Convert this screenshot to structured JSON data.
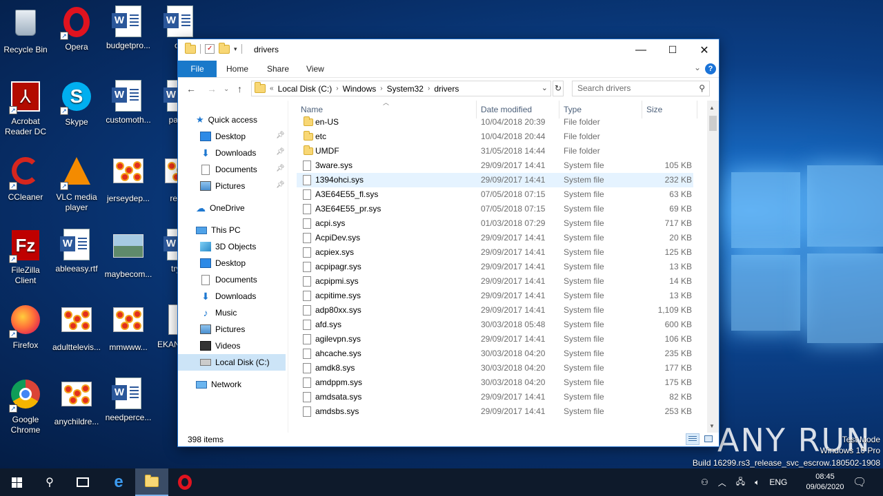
{
  "desktop": {
    "icons": [
      {
        "label": "Recycle Bin",
        "icon": "recycle-bin-icon"
      },
      {
        "label": "Opera",
        "icon": "opera-icon"
      },
      {
        "label": "budgetpro...",
        "icon": "word-doc-icon"
      },
      {
        "label": "ofc",
        "icon": "word-doc-icon"
      },
      {
        "label": "Acrobat Reader DC",
        "icon": "acrobat-icon"
      },
      {
        "label": "Skype",
        "icon": "skype-icon"
      },
      {
        "label": "customoth...",
        "icon": "word-doc-icon"
      },
      {
        "label": "pages",
        "icon": "word-doc-icon"
      },
      {
        "label": "CCleaner",
        "icon": "ccleaner-icon"
      },
      {
        "label": "VLC media player",
        "icon": "vlc-icon"
      },
      {
        "label": "jerseydep...",
        "icon": "image-icon"
      },
      {
        "label": "result",
        "icon": "image-icon"
      },
      {
        "label": "FileZilla Client",
        "icon": "filezilla-icon"
      },
      {
        "label": "ableeasy.rtf",
        "icon": "word-doc-icon"
      },
      {
        "label": "maybecom...",
        "icon": "landscape-image-icon"
      },
      {
        "label": "tryve",
        "icon": "word-doc-icon"
      },
      {
        "label": "Firefox",
        "icon": "firefox-icon"
      },
      {
        "label": "adulttelevis...",
        "icon": "image-icon"
      },
      {
        "label": "mmwww...",
        "icon": "image-icon"
      },
      {
        "label": "EKAN ranso",
        "icon": "document-icon"
      },
      {
        "label": "Google Chrome",
        "icon": "chrome-icon"
      },
      {
        "label": "anychildre...",
        "icon": "image-icon"
      },
      {
        "label": "needperce...",
        "icon": "word-doc-icon"
      }
    ]
  },
  "window": {
    "title": "drivers",
    "controls": {
      "minimize": "—",
      "maximize": "☐",
      "close": "✕"
    }
  },
  "ribbon": {
    "tabs": [
      "File",
      "Home",
      "Share",
      "View"
    ],
    "expand_icon": "chevron-down-icon",
    "help": "?"
  },
  "navbar": {
    "back": "←",
    "forward": "→",
    "up": "↑",
    "overflow": "«",
    "breadcrumb": [
      "Local Disk (C:)",
      "Windows",
      "System32",
      "drivers"
    ],
    "search_placeholder": "Search drivers"
  },
  "nav_pane": {
    "quick_access": "Quick access",
    "quick_items": [
      "Desktop",
      "Downloads",
      "Documents",
      "Pictures"
    ],
    "onedrive": "OneDrive",
    "this_pc": "This PC",
    "pc_items": [
      "3D Objects",
      "Desktop",
      "Documents",
      "Downloads",
      "Music",
      "Pictures",
      "Videos",
      "Local Disk (C:)"
    ],
    "network": "Network"
  },
  "columns": {
    "name": "Name",
    "date": "Date modified",
    "type": "Type",
    "size": "Size"
  },
  "files": [
    {
      "name": "en-US",
      "date": "10/04/2018 20:39",
      "type": "File folder",
      "size": "",
      "kind": "folder"
    },
    {
      "name": "etc",
      "date": "10/04/2018 20:44",
      "type": "File folder",
      "size": "",
      "kind": "folder"
    },
    {
      "name": "UMDF",
      "date": "31/05/2018 14:44",
      "type": "File folder",
      "size": "",
      "kind": "folder"
    },
    {
      "name": "3ware.sys",
      "date": "29/09/2017 14:41",
      "type": "System file",
      "size": "105 KB",
      "kind": "file"
    },
    {
      "name": "1394ohci.sys",
      "date": "29/09/2017 14:41",
      "type": "System file",
      "size": "232 KB",
      "kind": "file"
    },
    {
      "name": "A3E64E55_fl.sys",
      "date": "07/05/2018 07:15",
      "type": "System file",
      "size": "63 KB",
      "kind": "file"
    },
    {
      "name": "A3E64E55_pr.sys",
      "date": "07/05/2018 07:15",
      "type": "System file",
      "size": "69 KB",
      "kind": "file"
    },
    {
      "name": "acpi.sys",
      "date": "01/03/2018 07:29",
      "type": "System file",
      "size": "717 KB",
      "kind": "file"
    },
    {
      "name": "AcpiDev.sys",
      "date": "29/09/2017 14:41",
      "type": "System file",
      "size": "20 KB",
      "kind": "file"
    },
    {
      "name": "acpiex.sys",
      "date": "29/09/2017 14:41",
      "type": "System file",
      "size": "125 KB",
      "kind": "file"
    },
    {
      "name": "acpipagr.sys",
      "date": "29/09/2017 14:41",
      "type": "System file",
      "size": "13 KB",
      "kind": "file"
    },
    {
      "name": "acpipmi.sys",
      "date": "29/09/2017 14:41",
      "type": "System file",
      "size": "14 KB",
      "kind": "file"
    },
    {
      "name": "acpitime.sys",
      "date": "29/09/2017 14:41",
      "type": "System file",
      "size": "13 KB",
      "kind": "file"
    },
    {
      "name": "adp80xx.sys",
      "date": "29/09/2017 14:41",
      "type": "System file",
      "size": "1,109 KB",
      "kind": "file"
    },
    {
      "name": "afd.sys",
      "date": "30/03/2018 05:48",
      "type": "System file",
      "size": "600 KB",
      "kind": "file"
    },
    {
      "name": "agilevpn.sys",
      "date": "29/09/2017 14:41",
      "type": "System file",
      "size": "106 KB",
      "kind": "file"
    },
    {
      "name": "ahcache.sys",
      "date": "30/03/2018 04:20",
      "type": "System file",
      "size": "235 KB",
      "kind": "file"
    },
    {
      "name": "amdk8.sys",
      "date": "30/03/2018 04:20",
      "type": "System file",
      "size": "177 KB",
      "kind": "file"
    },
    {
      "name": "amdppm.sys",
      "date": "30/03/2018 04:20",
      "type": "System file",
      "size": "175 KB",
      "kind": "file"
    },
    {
      "name": "amdsata.sys",
      "date": "29/09/2017 14:41",
      "type": "System file",
      "size": "82 KB",
      "kind": "file"
    },
    {
      "name": "amdsbs.sys",
      "date": "29/09/2017 14:41",
      "type": "System file",
      "size": "253 KB",
      "kind": "file"
    }
  ],
  "status": {
    "item_count": "398 items"
  },
  "watermark": "ANY RUN",
  "system_info": {
    "line1": "Test Mode",
    "line2": "Windows 10 Pro",
    "line3": "Build 16299.rs3_release_svc_escrow.180502-1908"
  },
  "taskbar": {
    "language": "ENG",
    "time": "08:45",
    "date": "09/06/2020"
  }
}
